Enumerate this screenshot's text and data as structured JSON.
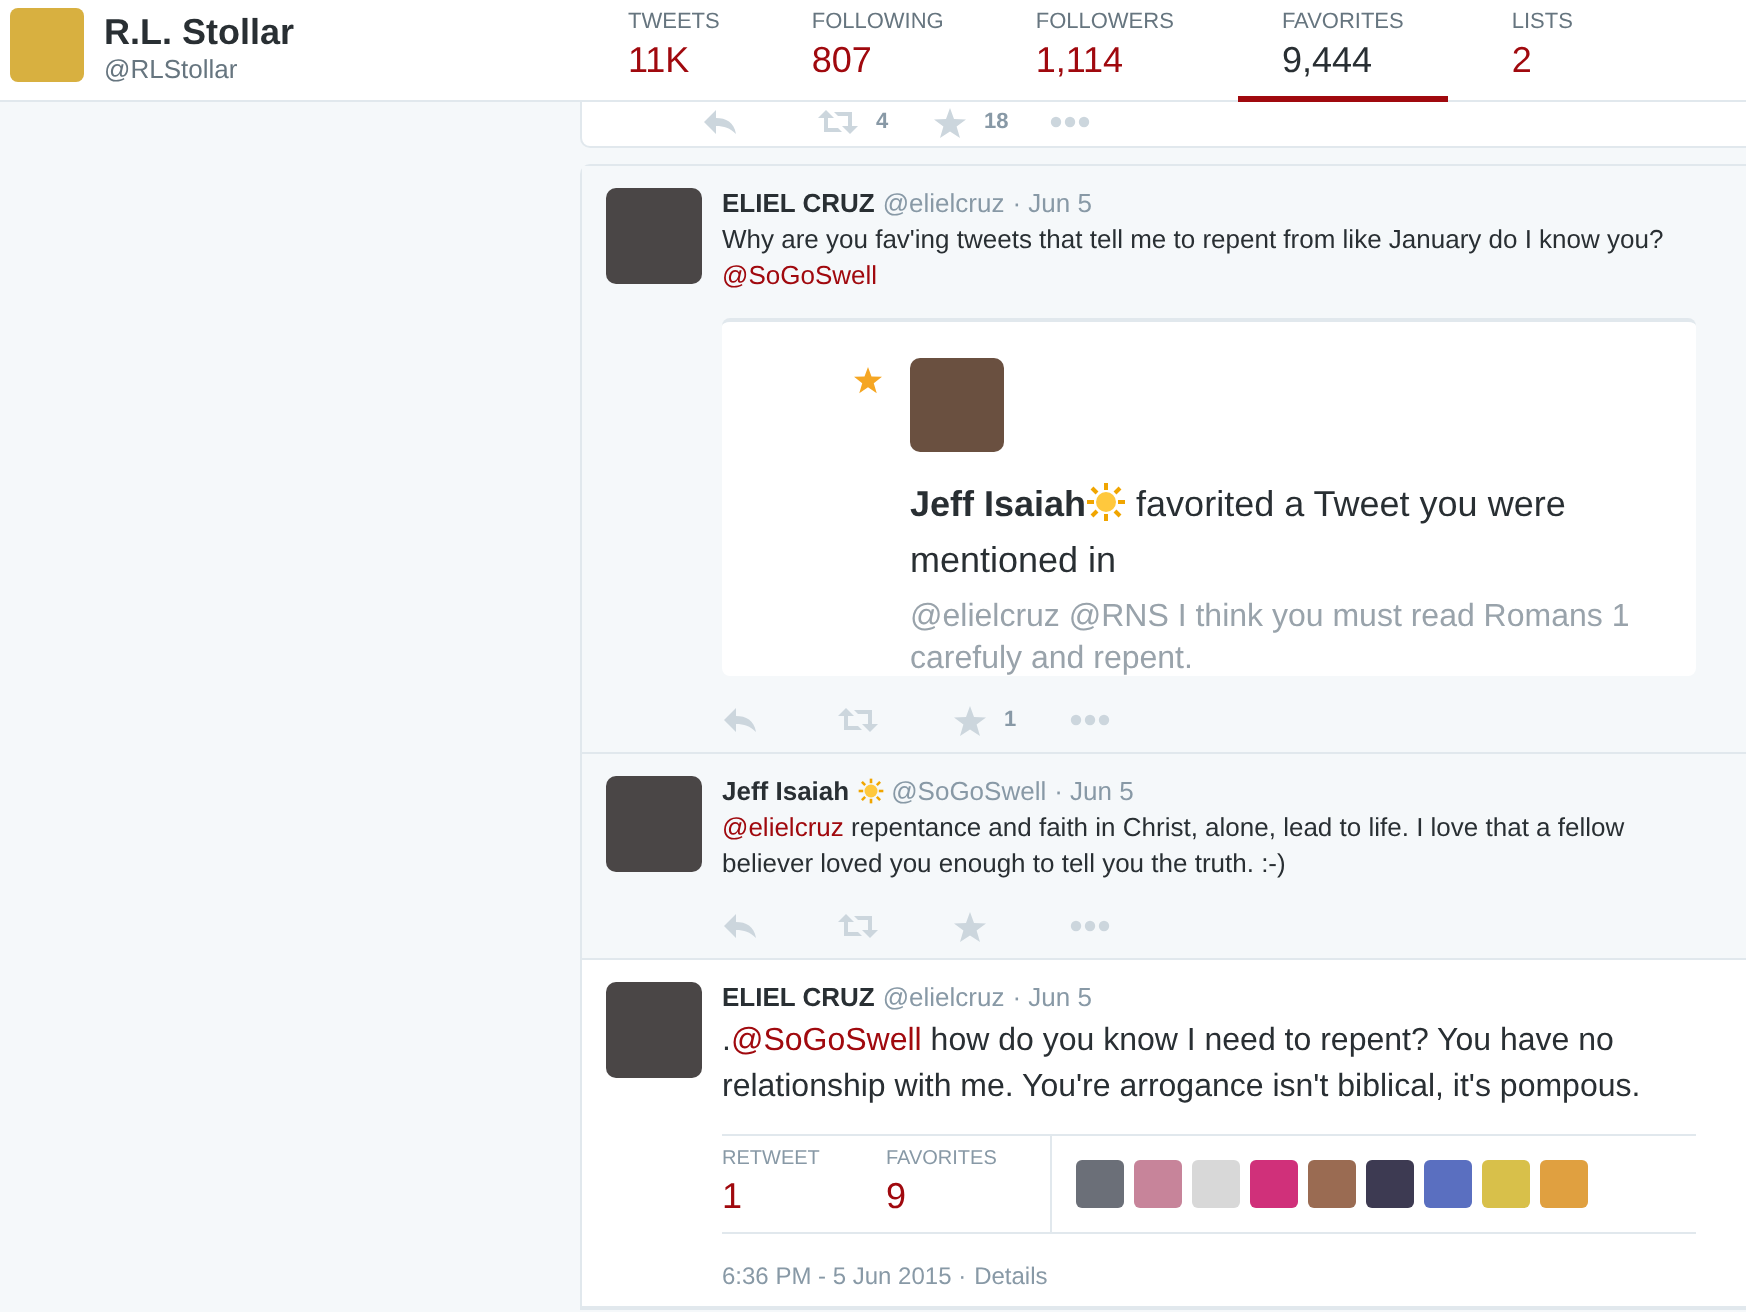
{
  "profile": {
    "name": "R.L. Stollar",
    "handle": "@RLStollar"
  },
  "stats": [
    {
      "label": "TWEETS",
      "value": "11K",
      "selected": false
    },
    {
      "label": "FOLLOWING",
      "value": "807",
      "selected": false
    },
    {
      "label": "FOLLOWERS",
      "value": "1,114",
      "selected": false
    },
    {
      "label": "FAVORITES",
      "value": "9,444",
      "selected": true
    },
    {
      "label": "LISTS",
      "value": "2",
      "selected": false
    }
  ],
  "previous_tweet": {
    "actions": [
      {
        "kind": "reply"
      },
      {
        "kind": "retweet",
        "count": "4"
      },
      {
        "kind": "favorite",
        "count": "18"
      },
      {
        "kind": "more"
      }
    ]
  },
  "tweets": [
    {
      "name": "ELIEL CRUZ",
      "name_emoji": false,
      "handle": "@elielcruz",
      "time": "· Jun 5",
      "focused": false,
      "text": [
        {
          "kind": "plain",
          "text": "Why are you fav'ing tweets that tell me to repent from like January do I know you? "
        },
        {
          "kind": "mention",
          "text": "@SoGoSwell"
        }
      ],
      "embed": {
        "title_name": "Jeff Isaiah",
        "title_rest": "favorited a Tweet you were mentioned in",
        "body": "@elielcruz @RNS I think you must read Romans 1 carefuly and repent."
      },
      "actions": [
        {
          "kind": "reply"
        },
        {
          "kind": "retweet"
        },
        {
          "kind": "favorite",
          "count": "1"
        },
        {
          "kind": "more"
        }
      ]
    },
    {
      "name": "Jeff Isaiah",
      "name_emoji": true,
      "handle": "@SoGoSwell",
      "time": "· Jun 5",
      "focused": false,
      "text": [
        {
          "kind": "mention",
          "text": "@elielcruz"
        },
        {
          "kind": "plain",
          "text": " repentance and faith in Christ, alone, lead to life. I love that a fellow believer loved you enough to tell you the truth. :-)"
        }
      ],
      "actions": [
        {
          "kind": "reply"
        },
        {
          "kind": "retweet"
        },
        {
          "kind": "favorite"
        },
        {
          "kind": "more"
        }
      ]
    },
    {
      "name": "ELIEL CRUZ",
      "name_emoji": false,
      "handle": "@elielcruz",
      "time": "· Jun 5",
      "focused": true,
      "text": [
        {
          "kind": "plain",
          "text": "."
        },
        {
          "kind": "mention",
          "text": "@SoGoSwell"
        },
        {
          "kind": "plain",
          "text": " how do you know I need to repent? You have no relationship with me. You're arrogance isn't biblical, it's pompous."
        }
      ],
      "stats": [
        {
          "label": "RETWEET",
          "value": "1"
        },
        {
          "label": "FAVORITES",
          "value": "9"
        }
      ],
      "favoriters": [
        {
          "color": "#6b6f78"
        },
        {
          "color": "#c7849a"
        },
        {
          "color": "#d8d8d8"
        },
        {
          "color": "#d0307a"
        },
        {
          "color": "#9a6b52"
        },
        {
          "color": "#3d3a52"
        },
        {
          "color": "#5a6fc0"
        },
        {
          "color": "#d8c04a"
        },
        {
          "color": "#e0a040"
        }
      ],
      "timestamp": "6:36 PM - 5 Jun 2015 ·",
      "details": "Details"
    }
  ]
}
